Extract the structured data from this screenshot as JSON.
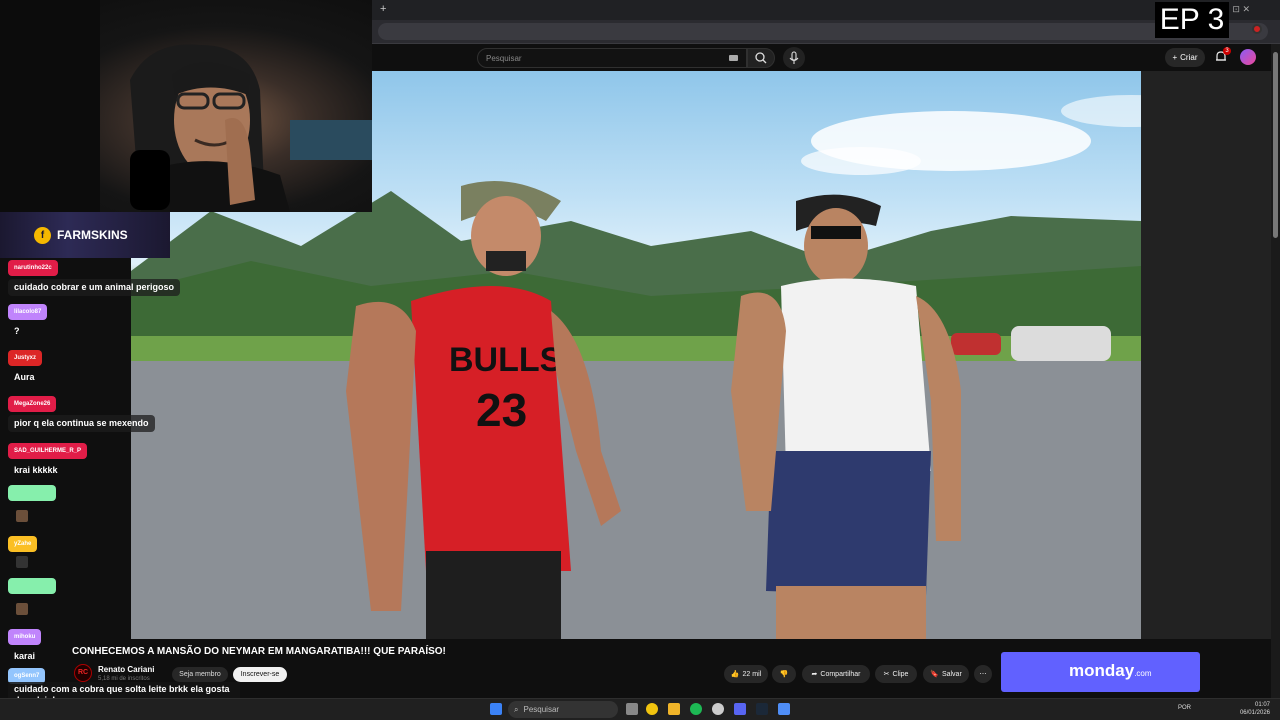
{
  "overlay": {
    "episode": "EP 3"
  },
  "youtube": {
    "search_placeholder": "Pesquisar",
    "create_label": "Criar",
    "notifications_count": "3",
    "video_title": "CONHECEMOS A MANSÃO DO NEYMAR EM MANGARATIBA!!! QUE PARAÍSO!",
    "channel": {
      "name": "Renato Cariani",
      "subscribers": "5,18 mi de inscritos",
      "logo_text": "RC"
    },
    "join_label": "Seja membro",
    "subscribe_label": "Inscrever-se",
    "likes": "22 mil",
    "share_label": "Compartilhar",
    "clip_label": "Clipe",
    "save_label": "Salvar"
  },
  "sponsor": {
    "name": "FARMSKINS"
  },
  "ad": {
    "brand": "monday",
    "suffix": ".com"
  },
  "chat": {
    "messages": [
      {
        "user": "narutinho22c",
        "text": "cuidado cobrar e um animal perigoso",
        "color": "#e11d48"
      },
      {
        "user": "lilacolo87",
        "text": "?",
        "color": "#c084fc"
      },
      {
        "user": "Justyxz",
        "text": "Aura",
        "color": "#dc2626"
      },
      {
        "user": "MegaZone26",
        "text": "pior q ela continua se mexendo",
        "color": "#e11d48"
      },
      {
        "user": "SAD_GUILHERME_R_P",
        "text": "krai kkkkk",
        "color": "#e11d48"
      },
      {
        "user": "",
        "text": "",
        "color": "#86efac"
      },
      {
        "user": "yZahe",
        "text": "",
        "color": "#fbbf24"
      },
      {
        "user": "",
        "text": "",
        "color": "#86efac"
      },
      {
        "user": "mihoku",
        "text": "karai",
        "color": "#c084fc"
      },
      {
        "user": "ogSenn7",
        "text": "cuidado com a cobra que solta leite brkk ela gosta de calvinhos",
        "color": "#93c5fd"
      }
    ]
  },
  "taskbar": {
    "search_label": "Pesquisar",
    "language": "POR",
    "time": "01:07",
    "date": "06/01/2026"
  }
}
